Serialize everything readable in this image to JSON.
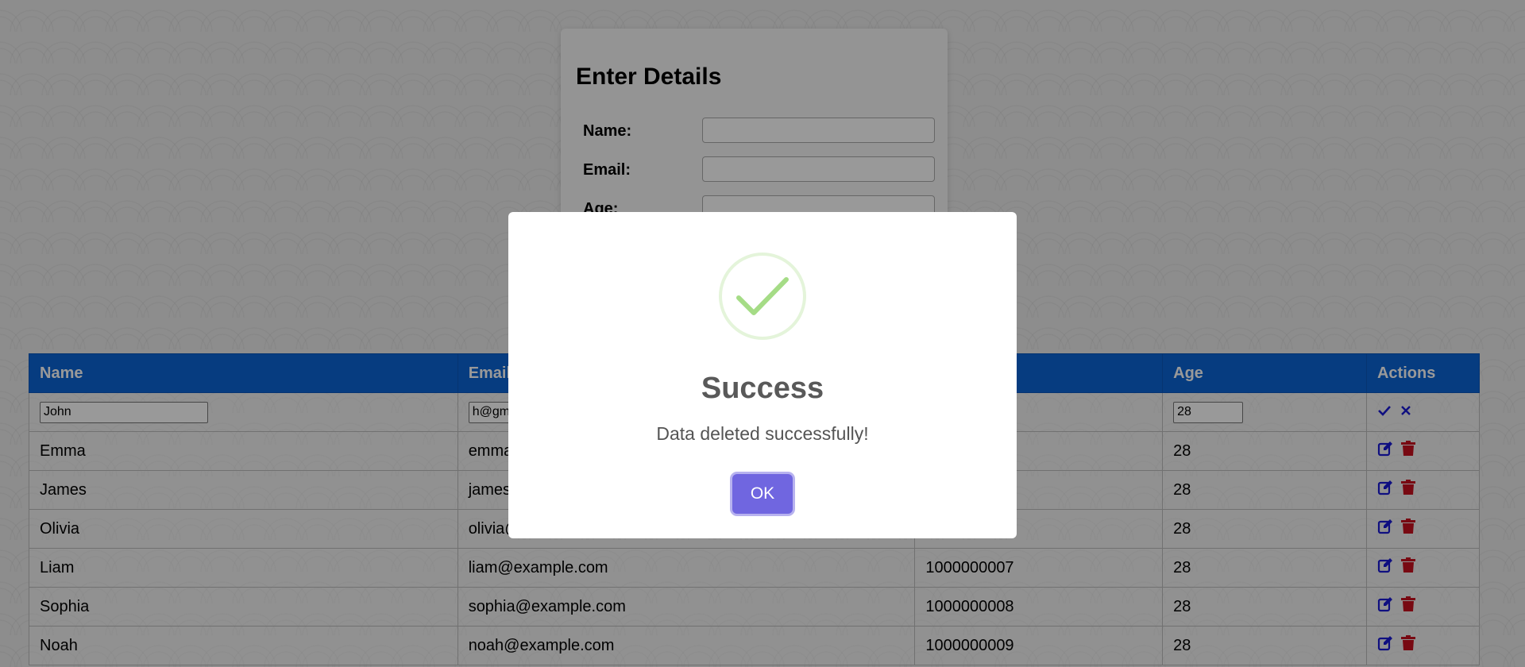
{
  "form": {
    "title": "Enter Details",
    "fields": [
      {
        "label": "Name:",
        "value": ""
      },
      {
        "label": "Email:",
        "value": ""
      },
      {
        "label": "Age:",
        "value": ""
      }
    ]
  },
  "table": {
    "headers": [
      "Name",
      "Email",
      "",
      "Age",
      "Actions"
    ],
    "edit_row": {
      "name": "John",
      "email": "h@gm",
      "phone": "",
      "age": "28"
    },
    "rows": [
      {
        "name": "Emma",
        "email": "emma",
        "phone": "",
        "age": "28"
      },
      {
        "name": "James",
        "email": "james",
        "phone": "",
        "age": "28"
      },
      {
        "name": "Olivia",
        "email": "olivia@",
        "phone": "",
        "age": "28"
      },
      {
        "name": "Liam",
        "email": "liam@example.com",
        "phone": "1000000007",
        "age": "28"
      },
      {
        "name": "Sophia",
        "email": "sophia@example.com",
        "phone": "1000000008",
        "age": "28"
      },
      {
        "name": "Noah",
        "email": "noah@example.com",
        "phone": "1000000009",
        "age": "28"
      }
    ],
    "icons": {
      "save": "check-icon",
      "cancel": "close-icon",
      "edit": "edit-icon",
      "delete": "trash-icon"
    }
  },
  "modal": {
    "title": "Success",
    "message": "Data deleted successfully!",
    "ok_label": "OK",
    "icon": "success-check-icon"
  },
  "colors": {
    "header_bg": "#0a64d6",
    "edit_icon": "#1a1ad6",
    "delete_icon": "#c8101e",
    "ok_button": "#7066e0",
    "success_green": "#a5dc86"
  }
}
